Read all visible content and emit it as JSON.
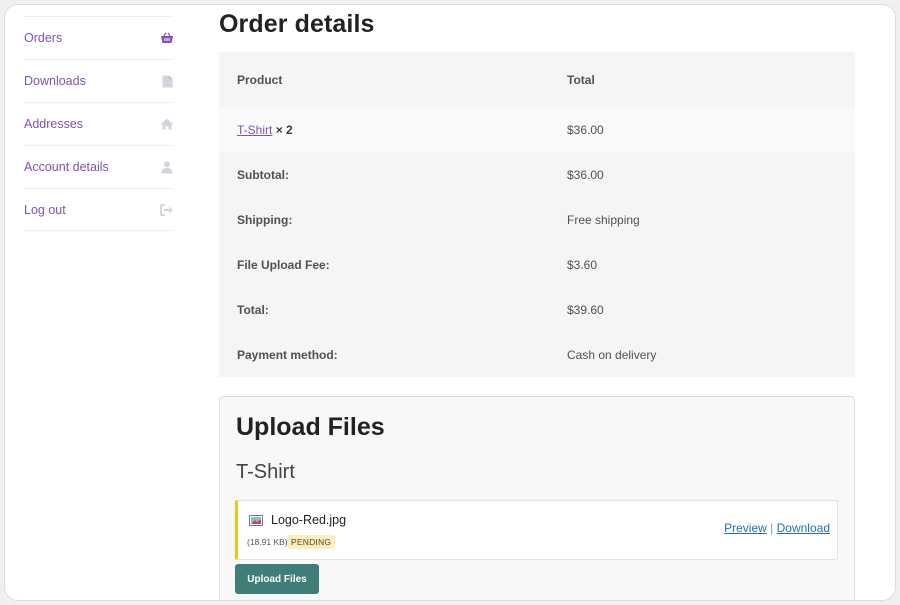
{
  "sidebar": {
    "items": [
      {
        "label": "Orders",
        "icon": "basket-icon"
      },
      {
        "label": "Downloads",
        "icon": "file-icon"
      },
      {
        "label": "Addresses",
        "icon": "home-icon"
      },
      {
        "label": "Account details",
        "icon": "user-icon"
      },
      {
        "label": "Log out",
        "icon": "sign-out-icon"
      }
    ]
  },
  "order": {
    "title": "Order details",
    "header": {
      "product": "Product",
      "total": "Total"
    },
    "item": {
      "name": "T-Shirt",
      "qty": "× 2",
      "total": "$36.00"
    },
    "rows": [
      {
        "label": "Subtotal:",
        "value": "$36.00"
      },
      {
        "label": "Shipping:",
        "value": "Free shipping"
      },
      {
        "label": "File Upload Fee:",
        "value": "$3.60"
      },
      {
        "label": "Total:",
        "value": "$39.60"
      },
      {
        "label": "Payment method:",
        "value": "Cash on delivery"
      }
    ]
  },
  "upload": {
    "title": "Upload Files",
    "product": "T-Shirt",
    "file": {
      "name": "Logo-Red.jpg",
      "size": "(18.91 KB)",
      "status": "PENDING",
      "preview_label": "Preview",
      "separator": "|",
      "download_label": "Download"
    },
    "button_label": "Upload Files"
  },
  "colors": {
    "accent": "#7f54b3",
    "link": "#2271b1",
    "button": "#3f7d79",
    "pending_bg": "#fbeec0",
    "pending_border": "#f0c419"
  }
}
